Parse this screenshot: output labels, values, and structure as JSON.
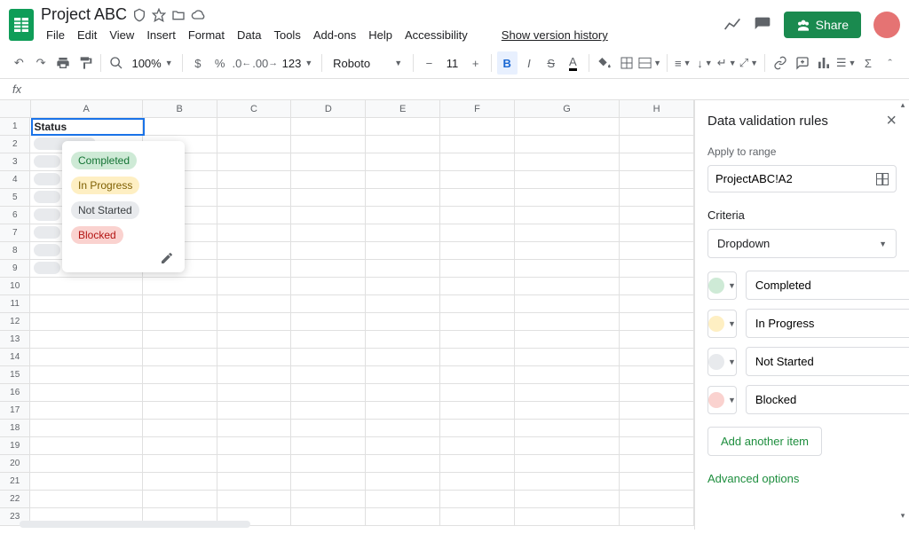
{
  "header": {
    "title": "Project ABC",
    "menus": [
      "File",
      "Edit",
      "View",
      "Insert",
      "Format",
      "Data",
      "Tools",
      "Add-ons",
      "Help",
      "Accessibility"
    ],
    "version_link": "Show version history",
    "share": "Share"
  },
  "toolbar": {
    "zoom": "100%",
    "decimal_fmt": "123",
    "font": "Roboto",
    "size": "11"
  },
  "formula": {
    "fx": "fx"
  },
  "sheet": {
    "columns": [
      "A",
      "B",
      "C",
      "D",
      "E",
      "F",
      "G",
      "H"
    ],
    "row_count": 23,
    "a1": "Status"
  },
  "dropdown": {
    "options": [
      {
        "label": "Completed",
        "cls": "chip-completed"
      },
      {
        "label": "In Progress",
        "cls": "chip-inprogress"
      },
      {
        "label": "Not Started",
        "cls": "chip-notstarted"
      },
      {
        "label": "Blocked",
        "cls": "chip-blocked"
      }
    ]
  },
  "panel": {
    "title": "Data validation rules",
    "apply_label": "Apply to range",
    "range": "ProjectABC!A2",
    "criteria_label": "Criteria",
    "criteria_type": "Dropdown",
    "items": [
      {
        "color": "dot-green",
        "value": "Completed"
      },
      {
        "color": "dot-yellow",
        "value": "In Progress"
      },
      {
        "color": "dot-gray",
        "value": "Not Started"
      },
      {
        "color": "dot-red",
        "value": "Blocked"
      }
    ],
    "add_item": "Add another item",
    "advanced": "Advanced options"
  }
}
